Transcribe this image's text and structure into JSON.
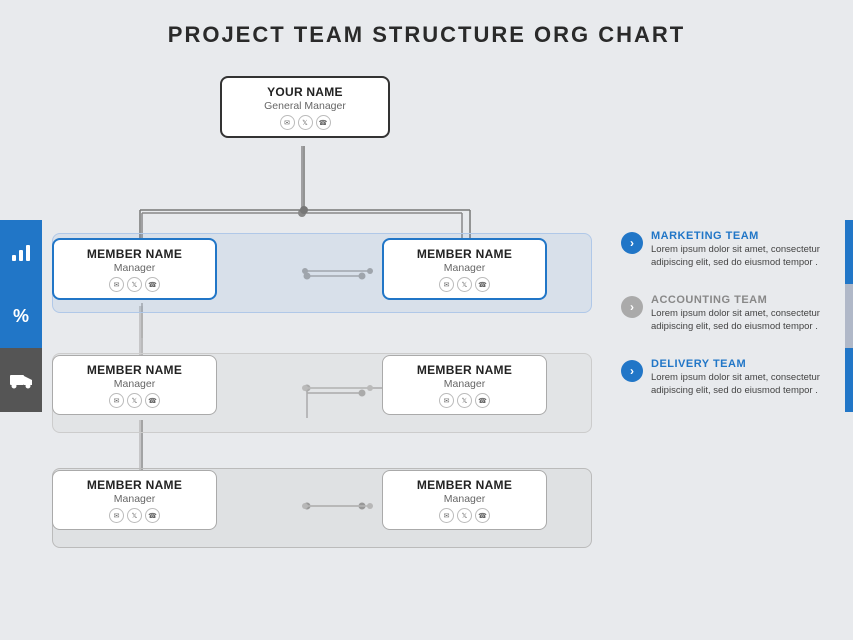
{
  "title": "PROJECT TEAM STRUCTURE ORG CHART",
  "top_node": {
    "name_part1": "YOUR",
    "name_part2": "NAME",
    "role": "General Manager",
    "icons": [
      "✉",
      "🐦",
      "📞"
    ]
  },
  "rows": [
    {
      "id": "row1",
      "band_color": "blue",
      "nodes": [
        {
          "name_part1": "MEMBER",
          "name_part2": "NAME",
          "role": "Manager",
          "border": "blue"
        },
        {
          "name_part1": "MEMBER",
          "name_part2": "NAME",
          "role": "Manager",
          "border": "blue"
        }
      ]
    },
    {
      "id": "row2",
      "band_color": "gray1",
      "nodes": [
        {
          "name_part1": "MEMBER",
          "name_part2": "NAME",
          "role": "Manager",
          "border": "gray"
        },
        {
          "name_part1": "MEMBER",
          "name_part2": "NAME",
          "role": "Manager",
          "border": "gray"
        }
      ]
    },
    {
      "id": "row3",
      "band_color": "gray2",
      "nodes": [
        {
          "name_part1": "MEMBER",
          "name_part2": "NAME",
          "role": "Manager",
          "border": "gray"
        },
        {
          "name_part1": "MEMBER",
          "name_part2": "NAME",
          "role": "Manager",
          "border": "gray"
        }
      ]
    }
  ],
  "sidebar_icons": [
    {
      "type": "blue",
      "symbol": "📊"
    },
    {
      "type": "mid",
      "symbol": "%"
    },
    {
      "type": "dark",
      "symbol": "🚚"
    }
  ],
  "info_panels": [
    {
      "team": "MARKETING TEAM",
      "color": "blue",
      "desc": "Lorem ipsum dolor sit amet, consectetur adipiscing elit, sed do eiusmod tempor ."
    },
    {
      "team": "ACCOUNTING TEAM",
      "color": "gray",
      "desc": "Lorem ipsum dolor sit amet, consectetur adipiscing elit, sed do eiusmod tempor ."
    },
    {
      "team": "DELIVERY TEAM",
      "color": "blue",
      "desc": "Lorem ipsum dolor sit amet, consectetur adipiscing elit, sed do eiusmod tempor ."
    }
  ]
}
